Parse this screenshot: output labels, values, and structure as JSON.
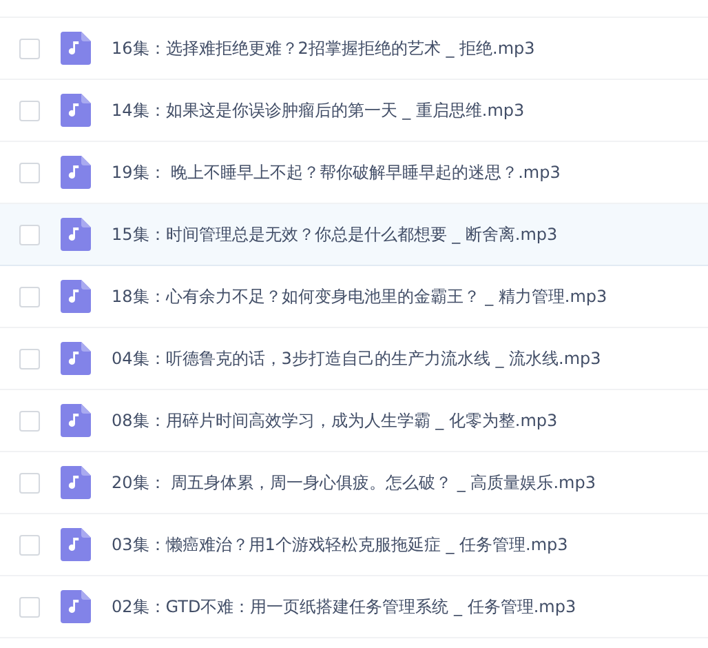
{
  "files": [
    {
      "name": "16集：选择难拒绝更难？2招掌握拒绝的艺术 _ 拒绝.mp3",
      "checked": false,
      "highlighted": false
    },
    {
      "name": "14集：如果这是你误诊肿瘤后的第一天 _ 重启思维.mp3",
      "checked": false,
      "highlighted": false
    },
    {
      "name": "19集： 晚上不睡早上不起？帮你破解早睡早起的迷思？.mp3",
      "checked": false,
      "highlighted": false
    },
    {
      "name": "15集：时间管理总是无效？你总是什么都想要 _ 断舍离.mp3",
      "checked": false,
      "highlighted": true
    },
    {
      "name": "18集：心有余力不足？如何变身电池里的金霸王？ _ 精力管理.mp3",
      "checked": false,
      "highlighted": false
    },
    {
      "name": "04集：听德鲁克的话，3步打造自己的生产力流水线 _ 流水线.mp3",
      "checked": false,
      "highlighted": false
    },
    {
      "name": "08集：用碎片时间高效学习，成为人生学霸 _ 化零为整.mp3",
      "checked": false,
      "highlighted": false
    },
    {
      "name": "20集： 周五身体累，周一身心俱疲。怎么破？ _ 高质量娱乐.mp3",
      "checked": false,
      "highlighted": false
    },
    {
      "name": "03集：懒癌难治？用1个游戏轻松克服拖延症 _ 任务管理.mp3",
      "checked": false,
      "highlighted": false
    },
    {
      "name": "02集：GTD不难：用一页纸搭建任务管理系统 _ 任务管理.mp3",
      "checked": false,
      "highlighted": false
    }
  ]
}
